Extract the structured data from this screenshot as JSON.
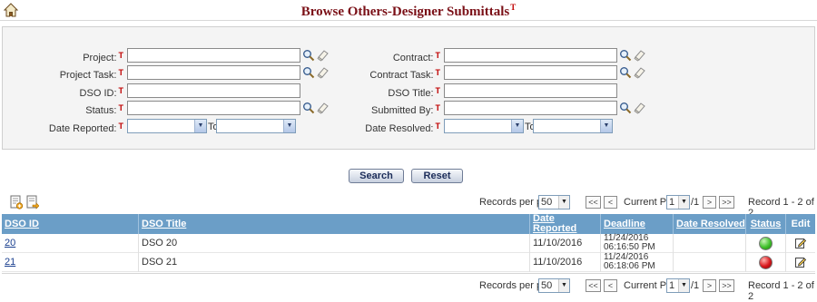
{
  "header": {
    "title": "Browse Others-Designer Submittals",
    "title_marker": "T"
  },
  "filters": {
    "marker": "T",
    "project_label": "Project:",
    "project_task_label": "Project Task:",
    "dso_id_label": "DSO ID:",
    "status_label": "Status:",
    "date_reported_label": "Date Reported:",
    "contract_label": "Contract:",
    "contract_task_label": "Contract Task:",
    "dso_title_label": "DSO Title:",
    "submitted_by_label": "Submitted By:",
    "date_resolved_label": "Date Resolved:",
    "to_label": "To"
  },
  "actions": {
    "search_label": "Search",
    "reset_label": "Reset"
  },
  "pager": {
    "records_per_page_label": "Records per page",
    "records_per_page_value": "50",
    "current_page_label": "Current Page",
    "current_page_value": "1",
    "total_pages": "/1",
    "first": "<<",
    "prev": "<",
    "next": ">",
    "last": ">>",
    "record_range": "Record 1 - 2 of 2"
  },
  "grid": {
    "columns": {
      "dso_id": "DSO ID",
      "dso_title": "DSO Title",
      "date_reported_line1": "Date",
      "date_reported_line2": "Reported",
      "deadline": "Deadline",
      "date_resolved": "Date Resolved",
      "status": "Status",
      "edit": "Edit"
    },
    "rows": [
      {
        "dso_id": "20",
        "dso_title": "DSO 20",
        "date_reported": "11/10/2016",
        "deadline_date": "11/24/2016",
        "deadline_time": "06:16:50 PM",
        "date_resolved": "",
        "status": "green"
      },
      {
        "dso_id": "21",
        "dso_title": "DSO 21",
        "date_reported": "11/10/2016",
        "deadline_date": "11/24/2016",
        "deadline_time": "06:18:06 PM",
        "date_resolved": "",
        "status": "red"
      }
    ]
  },
  "colors": {
    "title": "#7a0f16",
    "required_marker": "#c00000",
    "grid_header": "#6b9ec7",
    "status_green": "#3fc02a",
    "status_red": "#d8161b"
  },
  "icons": {
    "home": "home-icon",
    "lookup": "magnifier-icon",
    "clear": "eraser-icon",
    "add_record": "add-record-icon",
    "export": "export-icon",
    "edit": "edit-icon"
  }
}
